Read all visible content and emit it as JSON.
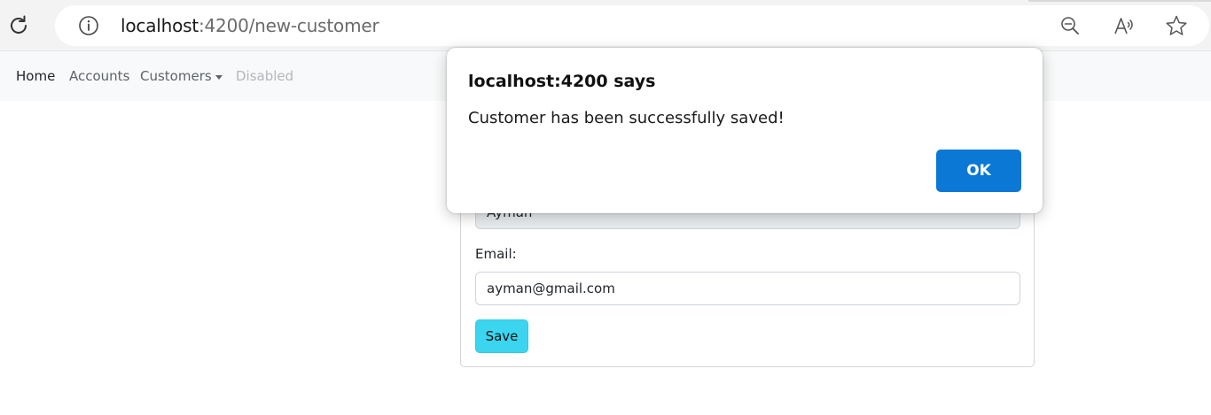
{
  "browser": {
    "url_host": "localhost",
    "url_rest": ":4200/new-customer"
  },
  "nav": {
    "home": "Home",
    "accounts": "Accounts",
    "customers": "Customers",
    "disabled": "Disabled"
  },
  "form": {
    "name_value": "Ayman",
    "email_label": "Email:",
    "email_value": "ayman@gmail.com",
    "save_label": "Save"
  },
  "dialog": {
    "title": "localhost:4200 says",
    "message": "Customer has been successfully saved!",
    "ok_label": "OK"
  },
  "colors": {
    "ok_button": "#0a78d4",
    "save_button": "#3bd5f0",
    "navbar_bg": "#f8f9fa"
  },
  "icons": [
    "reload-icon",
    "info-icon",
    "zoom-out-icon",
    "read-aloud-icon",
    "favorite-star-icon",
    "chevron-down-icon"
  ]
}
